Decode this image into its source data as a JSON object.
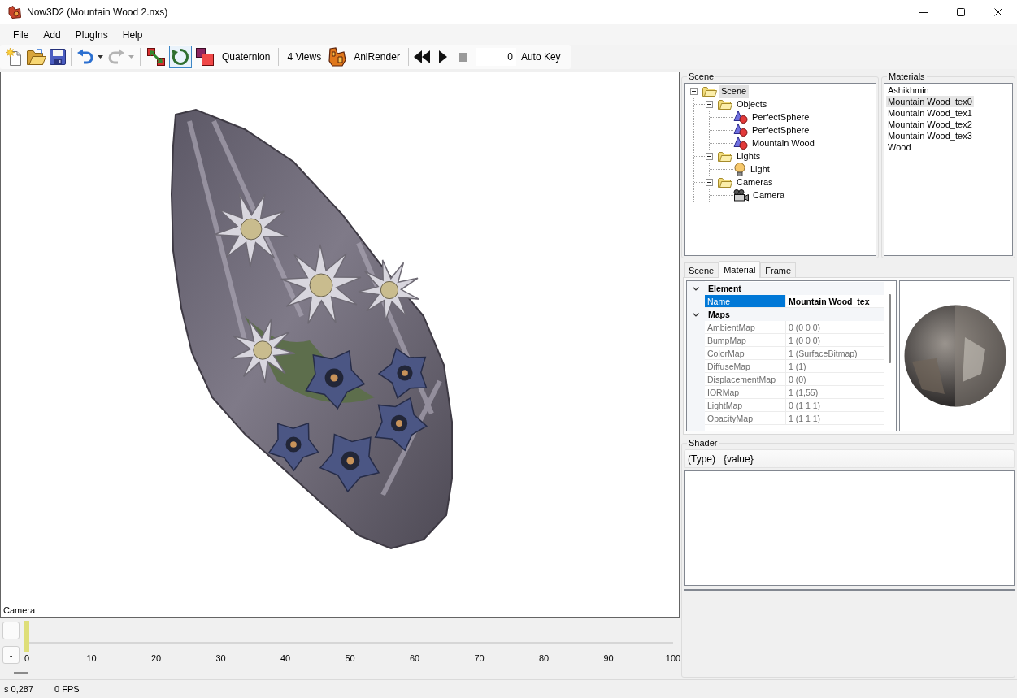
{
  "window": {
    "title": "Now3D2 (Mountain Wood 2.nxs)"
  },
  "menu": [
    "File",
    "Add",
    "PlugIns",
    "Help"
  ],
  "toolbar": {
    "history": [
      {
        "disabled": false
      },
      {
        "disabled": true
      }
    ],
    "transform_tools": [
      {
        "selected": false
      },
      {
        "selected": true
      },
      {
        "selected": false
      }
    ],
    "rotation_mode": "Quaternion",
    "views": "4 Views",
    "render": "AniRender",
    "playback": [
      {
        "disabled": false
      },
      {
        "disabled": false
      },
      {
        "disabled": true
      }
    ],
    "frame": "0",
    "auto_key": "Auto Key"
  },
  "viewport": {
    "label": "Camera"
  },
  "timeline": {
    "zoom_buttons": [
      "+",
      "-"
    ],
    "ticks": [
      "0",
      "10",
      "20",
      "30",
      "40",
      "50",
      "60",
      "70",
      "80",
      "90",
      "100"
    ],
    "level": 0
  },
  "status_bar": [
    "s 0,287",
    "0 FPS"
  ],
  "scene_panel": {
    "title": "Scene",
    "tree": [
      {
        "label": "Scene",
        "kind": "folder",
        "expanded": true,
        "selected": true,
        "children": [
          {
            "label": "Objects",
            "kind": "folder",
            "expanded": true,
            "selected": false,
            "children": [
              {
                "label": "PerfectSphere",
                "kind": "object",
                "selected": false
              },
              {
                "label": "PerfectSphere",
                "kind": "object",
                "selected": false
              },
              {
                "label": "Mountain Wood",
                "kind": "object",
                "selected": false
              }
            ]
          },
          {
            "label": "Lights",
            "kind": "folder",
            "expanded": true,
            "selected": false,
            "children": [
              {
                "label": "Light",
                "kind": "light",
                "selected": false
              }
            ]
          },
          {
            "label": "Cameras",
            "kind": "folder",
            "expanded": true,
            "selected": false,
            "children": [
              {
                "label": "Camera",
                "kind": "camera",
                "selected": false
              }
            ]
          }
        ]
      }
    ]
  },
  "materials_panel": {
    "title": "Materials",
    "items": [
      {
        "label": "Ashikhmin",
        "selected": false
      },
      {
        "label": "Mountain Wood_tex0",
        "selected": true
      },
      {
        "label": "Mountain Wood_tex1",
        "selected": false
      },
      {
        "label": "Mountain Wood_tex2",
        "selected": false
      },
      {
        "label": "Mountain Wood_tex3",
        "selected": false
      },
      {
        "label": "Wood",
        "selected": false
      }
    ]
  },
  "tabs": [
    {
      "label": "Scene",
      "selected": false
    },
    {
      "label": "Material",
      "selected": true
    },
    {
      "label": "Frame",
      "selected": false
    }
  ],
  "property_grid": {
    "categories": [
      {
        "label": "Element",
        "expanded": true,
        "rows": [
          {
            "name": "Name",
            "value": "Mountain Wood_tex",
            "selected": true,
            "read_only": false
          }
        ]
      },
      {
        "label": "Maps",
        "expanded": true,
        "rows": [
          {
            "name": "AmbientMap",
            "value": "0 (0 0 0)",
            "selected": false,
            "read_only": true
          },
          {
            "name": "BumpMap",
            "value": "1 (0 0 0)",
            "selected": false,
            "read_only": true
          },
          {
            "name": "ColorMap",
            "value": "1 (SurfaceBitmap)",
            "selected": false,
            "read_only": true
          },
          {
            "name": "DiffuseMap",
            "value": "1 (1)",
            "selected": false,
            "read_only": true
          },
          {
            "name": "DisplacementMap",
            "value": "0 (0)",
            "selected": false,
            "read_only": true
          },
          {
            "name": "IORMap",
            "value": "1 (1,55)",
            "selected": false,
            "read_only": true
          },
          {
            "name": "LightMap",
            "value": "0 (1 1 1)",
            "selected": false,
            "read_only": true
          },
          {
            "name": "OpacityMap",
            "value": "1 (1 1 1)",
            "selected": false,
            "read_only": true
          }
        ]
      }
    ]
  },
  "shader": {
    "title": "Shader",
    "columns": [
      "(Type)",
      "{value}"
    ]
  }
}
